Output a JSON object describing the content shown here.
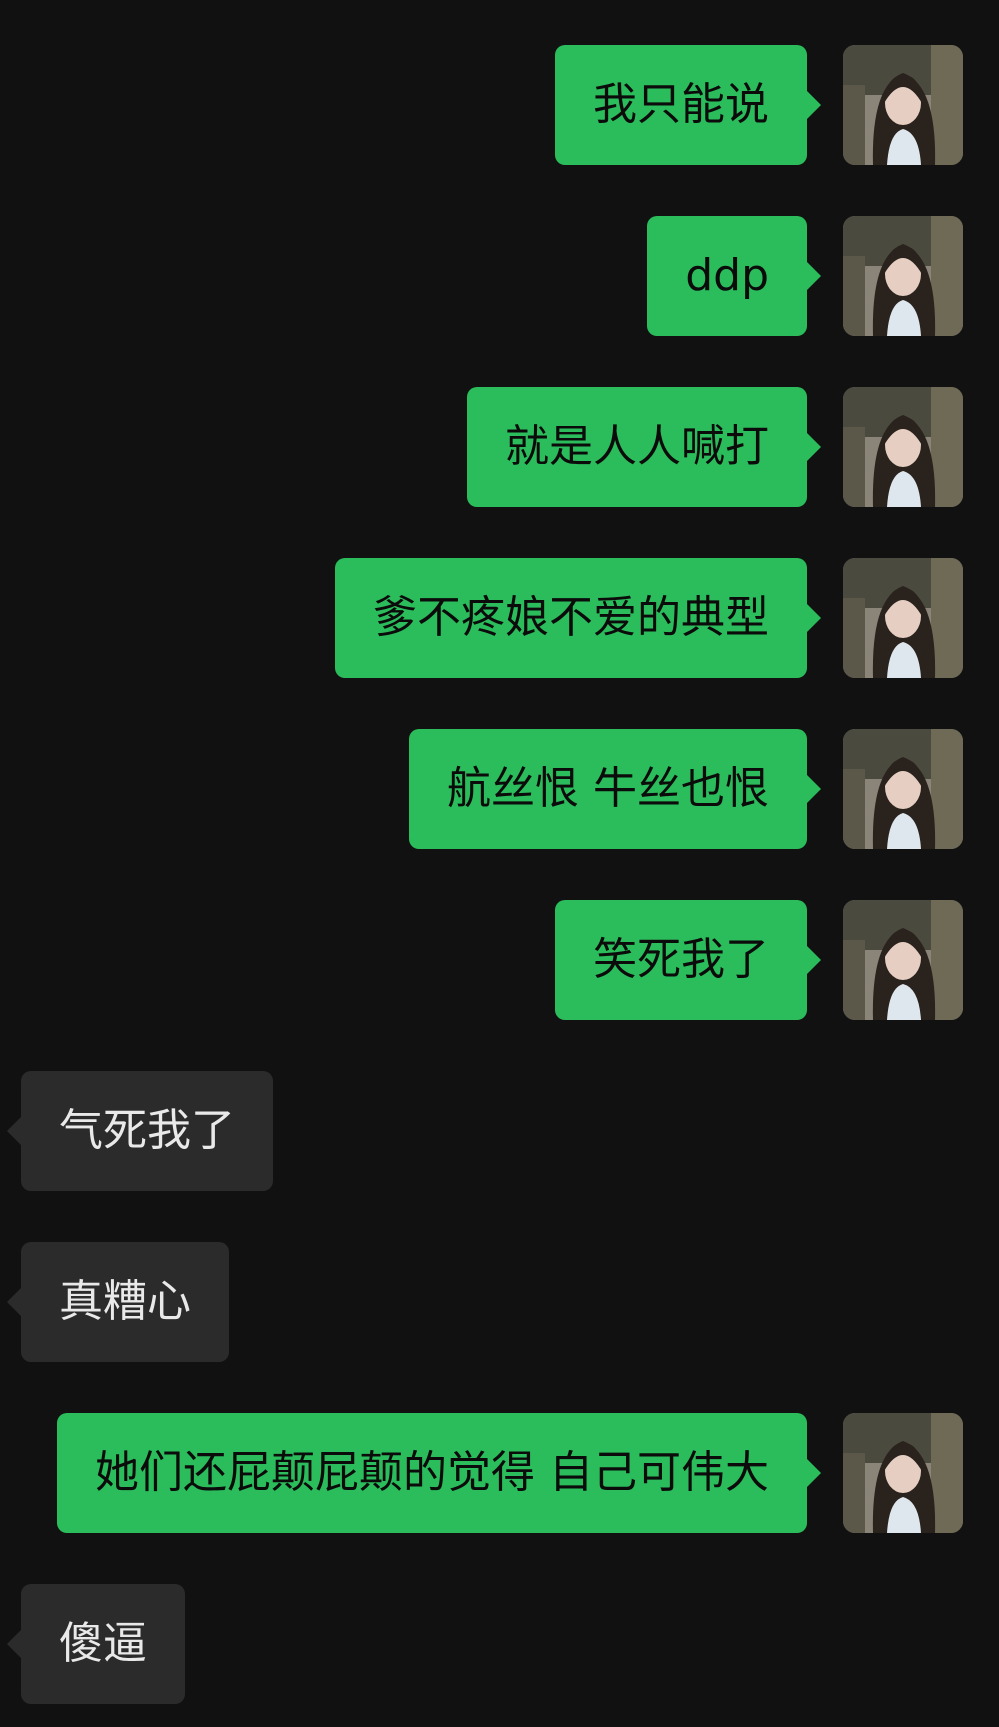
{
  "messages": [
    {
      "side": "out",
      "text": "我只能说"
    },
    {
      "side": "out",
      "text": "ddp"
    },
    {
      "side": "out",
      "text": "就是人人喊打"
    },
    {
      "side": "out",
      "text": "爹不疼娘不爱的典型"
    },
    {
      "side": "out",
      "text": "航丝恨 牛丝也恨"
    },
    {
      "side": "out",
      "text": "笑死我了"
    },
    {
      "side": "in",
      "text": "气死我了"
    },
    {
      "side": "in",
      "text": "真糟心"
    },
    {
      "side": "out",
      "text": "她们还屁颠屁颠的觉得 自己可伟大"
    },
    {
      "side": "in",
      "text": "傻逼"
    }
  ],
  "colors": {
    "background": "#111111",
    "outgoing_bubble": "#2bbd5b",
    "incoming_bubble": "#2b2b2b"
  },
  "icons": {
    "avatar": "user-avatar-photo-icon"
  }
}
